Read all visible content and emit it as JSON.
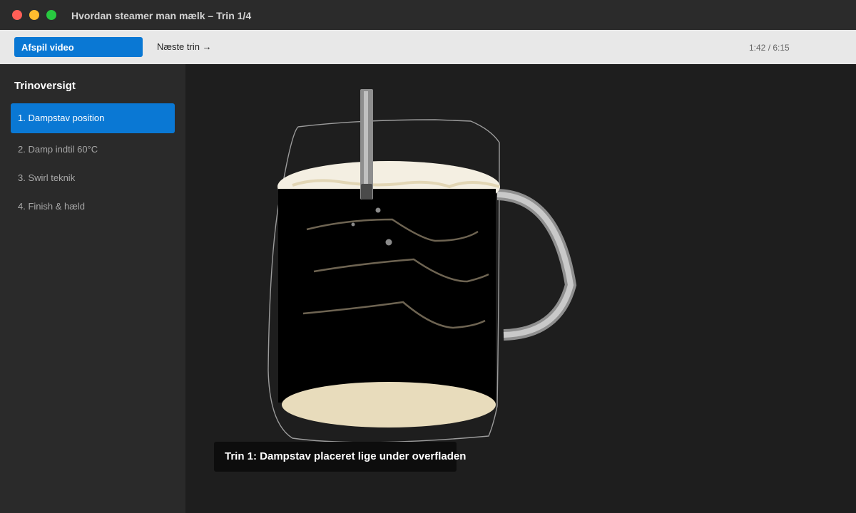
{
  "window": {
    "title": "Hvordan steamer man mælk – Trin 1/4"
  },
  "toolbar": {
    "play_label": "Afspil video",
    "next_label": "Næste trin →",
    "timecode": "1:42 / 6:15"
  },
  "sidebar": {
    "heading": "Trinoversigt",
    "items": [
      {
        "label": "1. Dampstav position",
        "active": true
      },
      {
        "label": "2. Damp indtil 60°C",
        "active": false
      },
      {
        "label": "3. Swirl teknik",
        "active": false
      },
      {
        "label": "4. Finish & hæld",
        "active": false
      }
    ]
  },
  "main": {
    "caption": "Trin 1: Dampstav placeret lige under overfladen"
  },
  "colors": {
    "accent": "#0a78d4",
    "milk_foam": "#f4efe2",
    "milk_base": "#e8dcbc",
    "swirl": "#6e6452",
    "close": "#ff5f57",
    "minimize": "#febc2e",
    "zoom": "#28c840"
  },
  "icons": {
    "traffic_lights": [
      "close-dot",
      "minimize-dot",
      "zoom-dot"
    ]
  }
}
